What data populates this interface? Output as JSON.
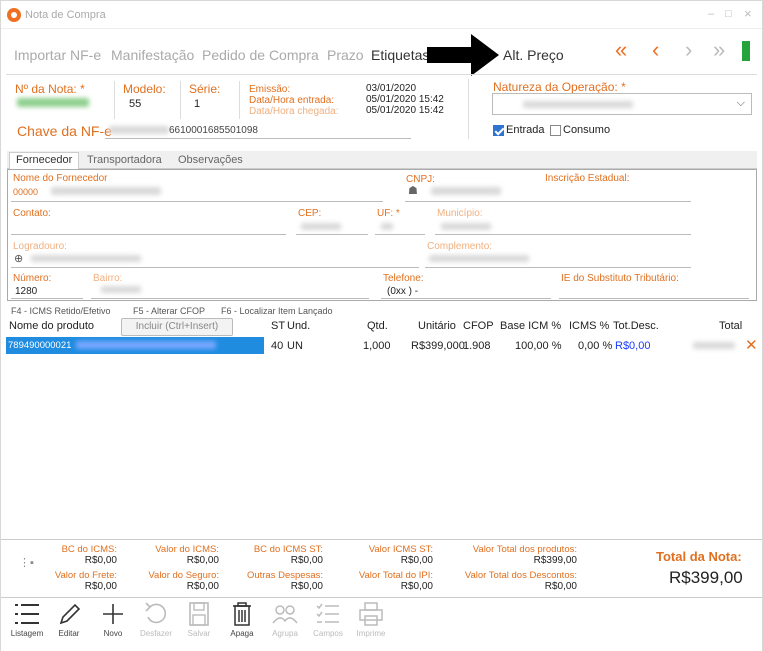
{
  "window": {
    "title": "Nota de Compra",
    "minimize": "–",
    "maximize": "□",
    "close": "×"
  },
  "menu": {
    "items": [
      "Importar NF-e",
      "Manifestação",
      "Pedido de Compra",
      "Prazo",
      "Etiquetas",
      "Alt. Preço"
    ],
    "nav": {
      "first": "«",
      "prev": "‹",
      "next": "›",
      "last": "»"
    }
  },
  "header": {
    "num_nota_label": "Nº da Nota: *",
    "modelo_label": "Modelo:",
    "modelo_value": "55",
    "serie_label": "Série:",
    "serie_value": "1",
    "emissao_label": "Emissão:",
    "emissao_value": "03/01/2020",
    "entrada_label": "Data/Hora entrada:",
    "entrada_value": "05/01/2020  15:42",
    "chegada_label": "Data/Hora chegada:",
    "chegada_value": "05/01/2020  15:42",
    "chave_label": "Chave da NF-e",
    "chave_value": "6610001685501098",
    "natureza_label": "Natureza da Operação: *",
    "entrada_chk": "Entrada",
    "consumo_chk": "Consumo"
  },
  "tabs": [
    "Fornecedor",
    "Transportadora",
    "Observações"
  ],
  "fornecedor": {
    "nome_label": "Nome do Fornecedor",
    "nome_code": "00000",
    "cnpj_label": "CNPJ:",
    "ie_label": "Inscrição Estadual:",
    "contato_label": "Contato:",
    "cep_label": "CEP:",
    "uf_label": "UF: *",
    "municipio_label": "Município:",
    "logradouro_label": "Logradouro:",
    "complemento_label": "Complemento:",
    "numero_label": "Número:",
    "numero_value": "1280",
    "bairro_label": "Bairro:",
    "telefone_label": "Telefone:",
    "telefone_value": "(0xx  )  -",
    "ie_sub_label": "IE do Substituto Tributário:"
  },
  "shortcuts": [
    "F4 - ICMS Retido/Efetivo",
    "F5 - Alterar CFOP",
    "F6 - Localizar Item Lançado"
  ],
  "grid": {
    "headers": {
      "nome": "Nome do produto",
      "st": "ST",
      "und": "Und.",
      "qtd": "Qtd.",
      "unitario": "Unitário",
      "cfop": "CFOP",
      "base": "Base ICM %",
      "icms": "ICMS %",
      "totdesc": "Tot.Desc.",
      "total": "Total"
    },
    "include_button": "Incluir (Ctrl+Insert)",
    "rows": [
      {
        "codigo": "789490000021",
        "st": "40",
        "und": "UN",
        "qtd": "1,000",
        "unitario": "R$399,000",
        "cfop": "1.908",
        "base": "100,00 %",
        "icms": "0,00 %",
        "totdesc": "R$0,00"
      }
    ]
  },
  "totals": {
    "bc_icms": {
      "label": "BC do ICMS:",
      "value": "R$0,00"
    },
    "valor_icms": {
      "label": "Valor do ICMS:",
      "value": "R$0,00"
    },
    "bc_icms_st": {
      "label": "BC do ICMS ST:",
      "value": "R$0,00"
    },
    "valor_icms_st": {
      "label": "Valor ICMS ST:",
      "value": "R$0,00"
    },
    "valor_produtos": {
      "label": "Valor Total dos produtos:",
      "value": "R$399,00"
    },
    "frete": {
      "label": "Valor do Frete:",
      "value": "R$0,00"
    },
    "seguro": {
      "label": "Valor do Seguro:",
      "value": "R$0,00"
    },
    "outras": {
      "label": "Outras Despesas:",
      "value": "R$0,00"
    },
    "ipi": {
      "label": "Valor Total do IPI:",
      "value": "R$0,00"
    },
    "descontos": {
      "label": "Valor Total dos Descontos:",
      "value": "R$0,00"
    },
    "total_nota_label": "Total da Nota:",
    "total_nota_value": "R$399,00"
  },
  "toolbar": [
    "Listagem",
    "Editar",
    "Novo",
    "Desfazer",
    "Salvar",
    "Apaga",
    "Agrupa",
    "Campos",
    "Imprime"
  ],
  "colors": {
    "accent": "#e07020",
    "selection": "#1f8ce0",
    "status": "#27a33b"
  }
}
